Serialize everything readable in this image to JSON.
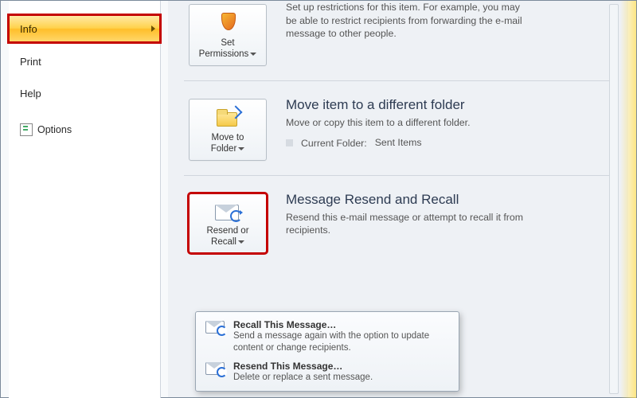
{
  "sidebar": {
    "entries": [
      {
        "label": "Info",
        "selected": true,
        "highlight": true
      },
      {
        "label": "Print"
      },
      {
        "label": "Help"
      }
    ],
    "options_label": "Options"
  },
  "sections": {
    "permissions": {
      "button_line1": "Set",
      "button_line2": "Permissions",
      "title": "",
      "desc": "Set up restrictions for this item. For example, you may be able to restrict recipients from forwarding the e-mail message to other people."
    },
    "move": {
      "button_line1": "Move to",
      "button_line2": "Folder",
      "title": "Move item to a different folder",
      "desc": "Move or copy this item to a different folder.",
      "folder_label": "Current Folder:",
      "folder_value": "Sent Items"
    },
    "resend": {
      "button_line1": "Resend or",
      "button_line2": "Recall",
      "title": "Message Resend and Recall",
      "desc": "Resend this e-mail message or attempt to recall it from recipients.",
      "highlight": true
    }
  },
  "menu": {
    "items": [
      {
        "title": "Recall This Message…",
        "desc": "Send a message again with the option to update content or change recipients."
      },
      {
        "title": "Resend This Message…",
        "desc": "Delete or replace a sent message."
      }
    ]
  }
}
